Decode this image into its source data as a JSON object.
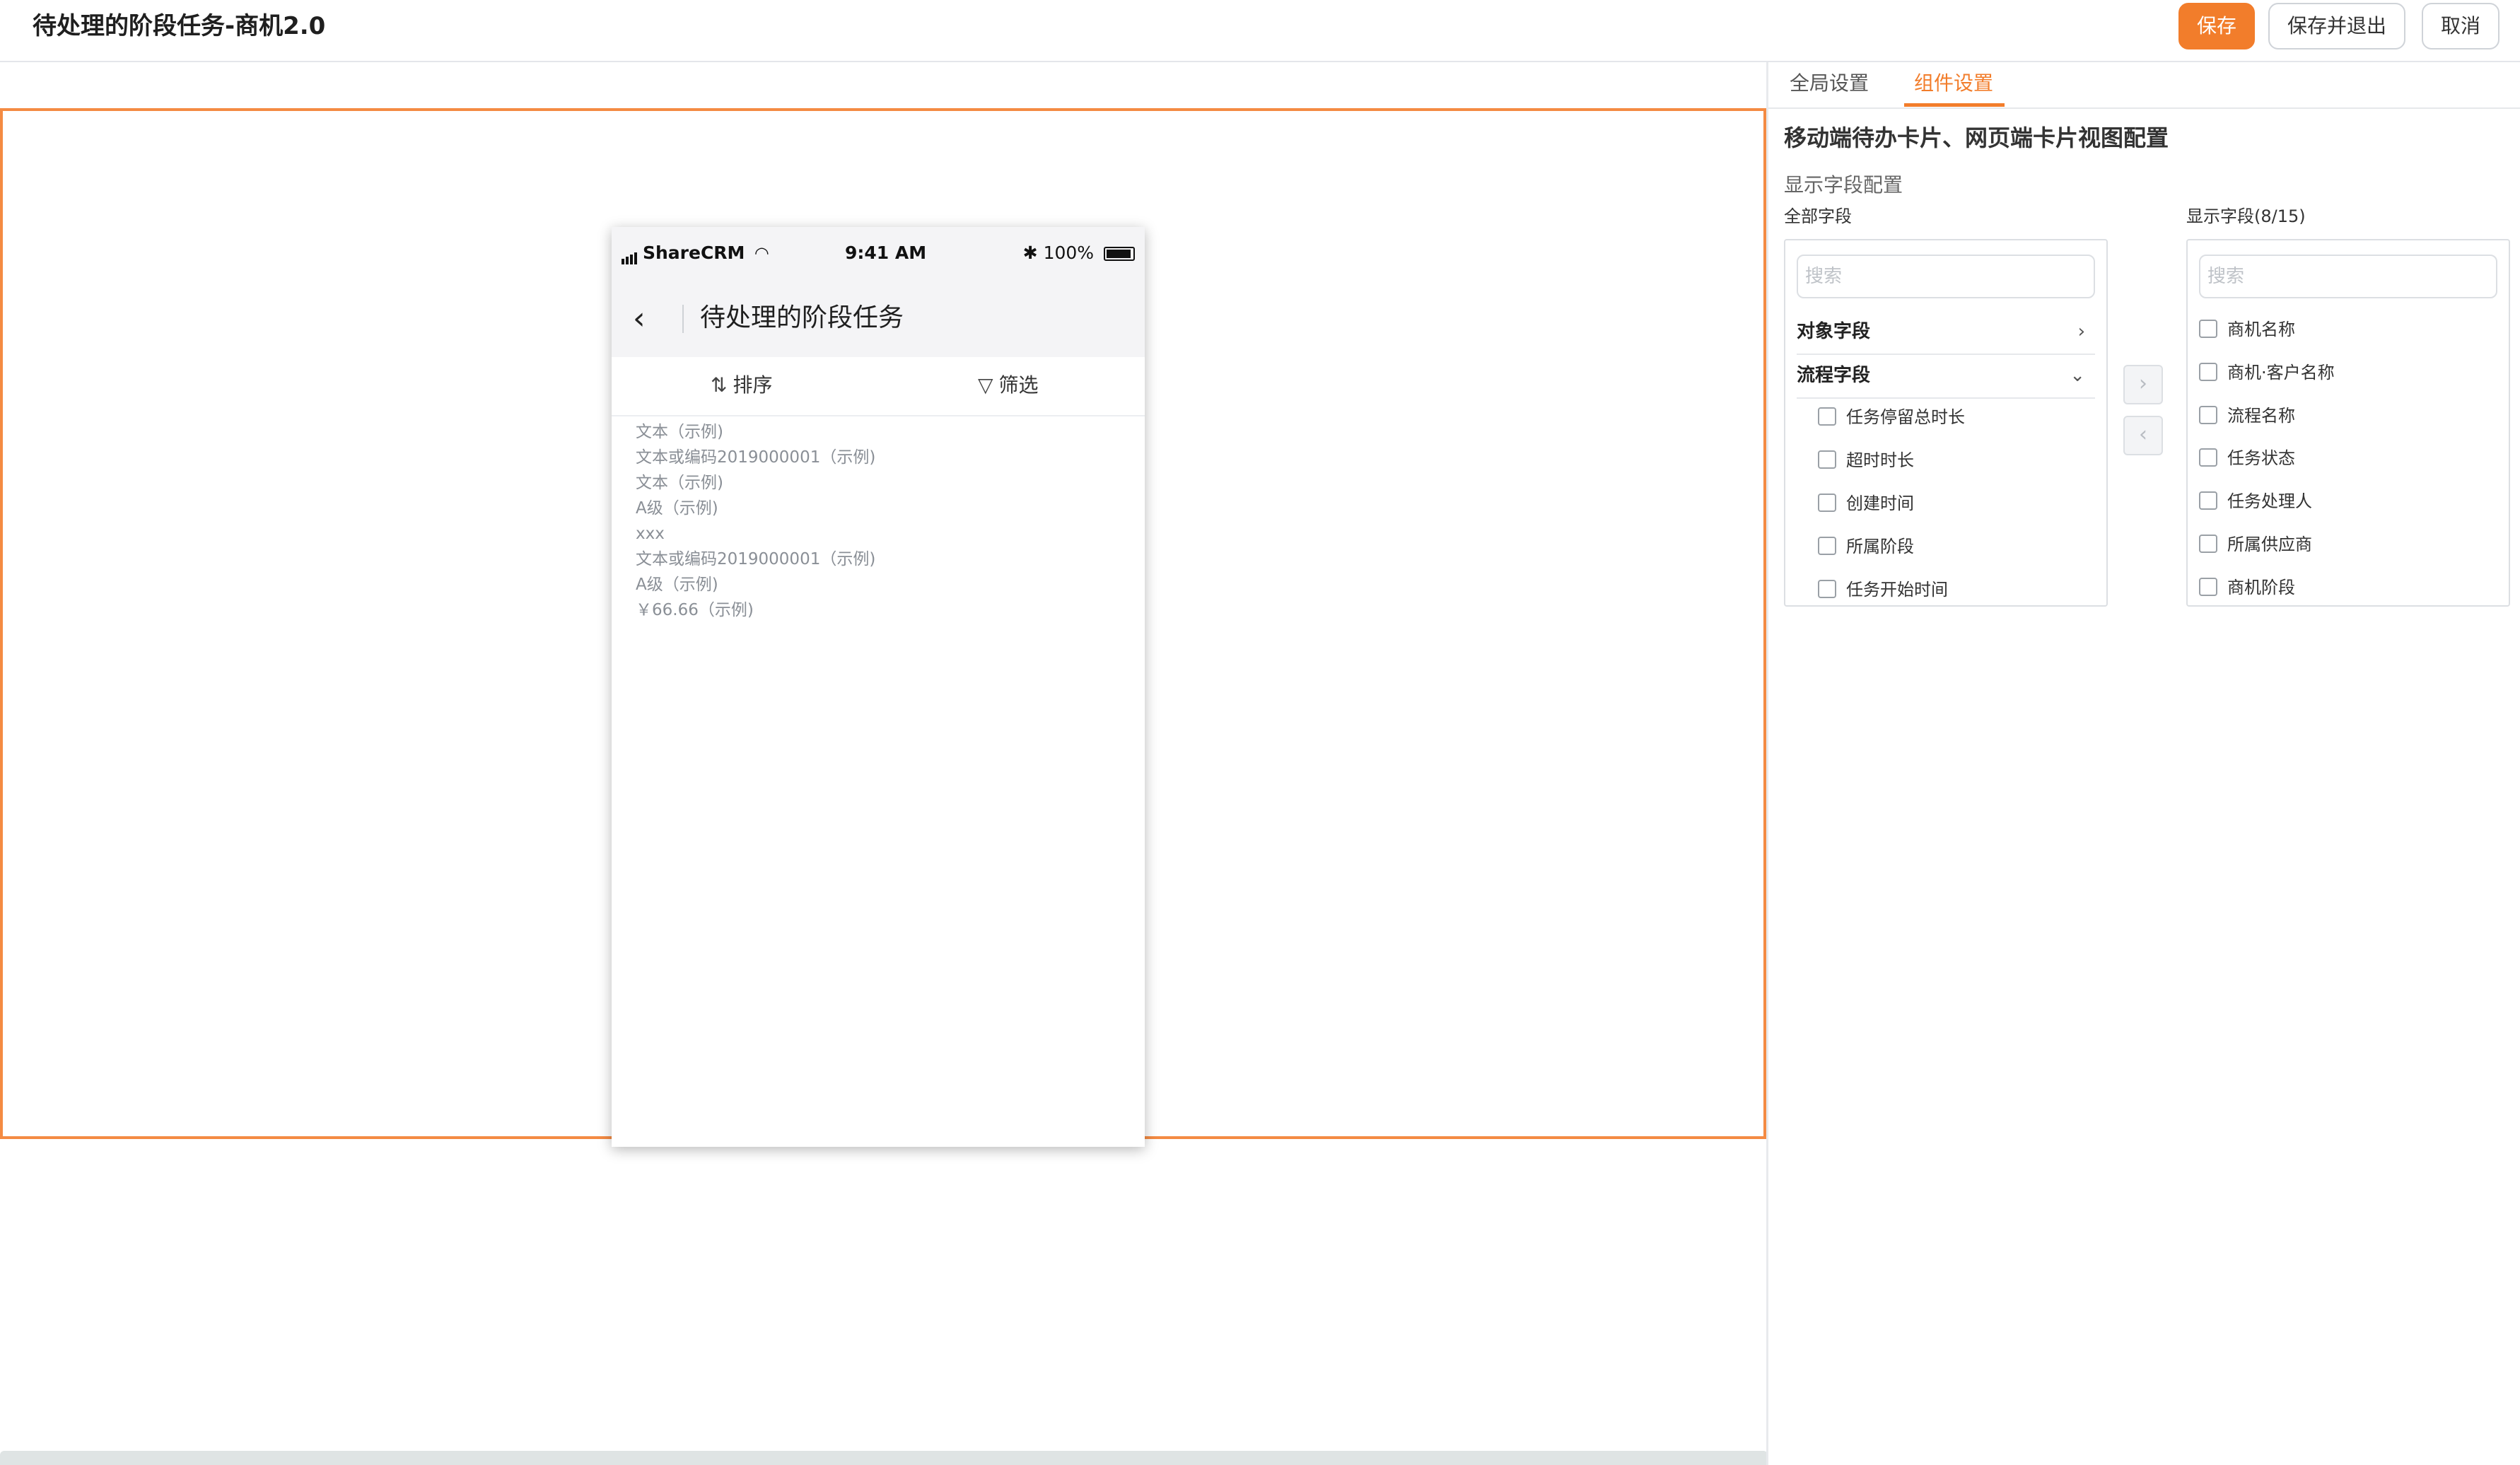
{
  "header": {
    "title": "待处理的阶段任务-商机2.0",
    "save_label": "保存",
    "save_exit_label": "保存并退出",
    "cancel_label": "取消"
  },
  "colors": {
    "accent": "#f27d2b",
    "frame": "#f48b43"
  },
  "phone": {
    "carrier": "ShareCRM",
    "time": "9:41 AM",
    "battery": "100%",
    "nav_title": "待处理的阶段任务",
    "sort_label": "排序",
    "filter_label": "筛选",
    "card_lines": [
      "文本（示例)",
      "文本或编码2019000001（示例)",
      "文本（示例)",
      "A级（示例)",
      "xxx",
      "文本或编码2019000001（示例)",
      "A级（示例)",
      "￥66.66（示例)"
    ]
  },
  "panel": {
    "tabs": {
      "global": "全局设置",
      "component": "组件设置"
    },
    "section_title": "移动端待办卡片、网页端卡片视图配置",
    "sub_title": "显示字段配置",
    "all_fields_label": "全部字段",
    "shown_fields_label": "显示字段(8/15)",
    "search_placeholder": "搜索",
    "groups": {
      "object": "对象字段",
      "process": "流程字段"
    },
    "process_fields": [
      "任务停留总时长",
      "超时时长",
      "创建时间",
      "所属阶段",
      "任务开始时间"
    ],
    "shown_fields": [
      "商机名称",
      "商机·客户名称",
      "流程名称",
      "任务状态",
      "任务处理人",
      "所属供应商",
      "商机阶段"
    ]
  }
}
